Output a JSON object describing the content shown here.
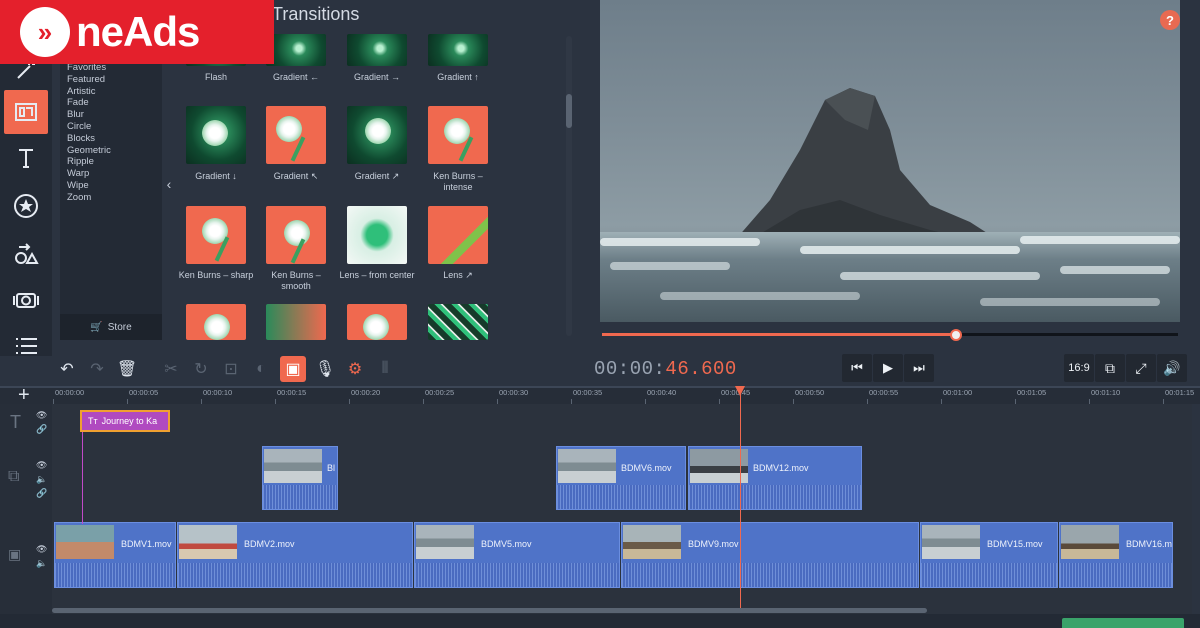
{
  "logo": {
    "text": "neAds"
  },
  "transitions": {
    "title": "Transitions",
    "categories": [
      "Favorites",
      "Featured",
      "Artistic",
      "Fade",
      "Blur",
      "Circle",
      "Blocks",
      "Geometric",
      "Ripple",
      "Warp",
      "Wipe",
      "Zoom"
    ],
    "store_label": "Store",
    "items": [
      {
        "label": "Flash"
      },
      {
        "label": "Gradient ←"
      },
      {
        "label": "Gradient →"
      },
      {
        "label": "Gradient ↑"
      },
      {
        "label": "Gradient ↓"
      },
      {
        "label": "Gradient ↖"
      },
      {
        "label": "Gradient ↗"
      },
      {
        "label": "Ken Burns – intense"
      },
      {
        "label": "Ken Burns – sharp"
      },
      {
        "label": "Ken Burns – smooth"
      },
      {
        "label": "Lens – from center"
      },
      {
        "label": "Lens ↗"
      }
    ]
  },
  "player": {
    "timecode_main": "00:00:",
    "timecode_accent": "46.600",
    "progress": 0.615,
    "aspect_label": "16:9",
    "help_label": "?"
  },
  "timeline": {
    "ticks": [
      "00:00:00",
      "00:00:05",
      "00:00:10",
      "00:00:15",
      "00:00:20",
      "00:00:25",
      "00:00:30",
      "00:00:35",
      "00:00:40",
      "00:00:45",
      "00:00:50",
      "00:00:55",
      "00:01:00",
      "00:01:05",
      "00:01:10",
      "00:01:15"
    ],
    "title_clip": "Journey to Ka",
    "overlay_clips": [
      {
        "name": "Bl"
      },
      {
        "name": "BDMV6.mov"
      },
      {
        "name": "BDMV12.mov"
      }
    ],
    "main_clips": [
      {
        "name": "BDMV1.mov"
      },
      {
        "name": "BDMV2.mov"
      },
      {
        "name": "BDMV5.mov"
      },
      {
        "name": "BDMV9.mov"
      },
      {
        "name": "BDMV15.mov"
      },
      {
        "name": "BDMV16.m"
      }
    ]
  },
  "colors": {
    "accent": "#f0694f",
    "clip": "#4f73c8",
    "title_clip": "#b04ac0",
    "logo": "#e4202c"
  }
}
